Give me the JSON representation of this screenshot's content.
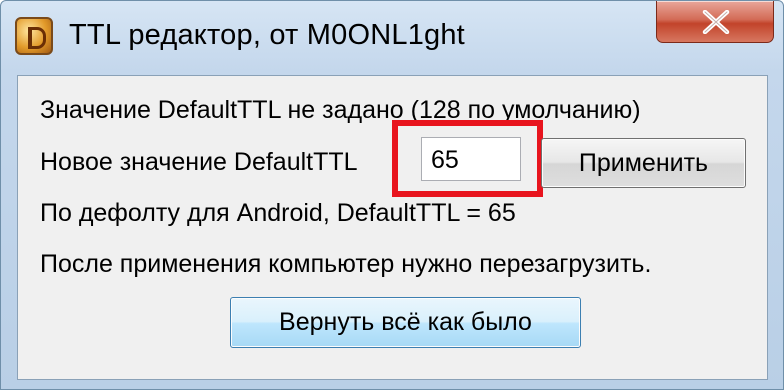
{
  "window": {
    "title": "TTL редактор, от M0ONL1ght",
    "close_icon": "close-icon",
    "app_icon": "app-icon"
  },
  "content": {
    "status_text": "Значение DefaultTTL не задано (128 по умолчанию)",
    "new_value_label": "Новое значение DefaultTTL",
    "ttl_input_value": "65",
    "apply_button": "Применить",
    "android_hint": "По дефолту для Android, DefaultTTL = 65",
    "restart_note": "После применения компьютер нужно перезагрузить.",
    "reset_button": "Вернуть всё как было"
  },
  "colors": {
    "highlight": "#e8141e",
    "close_button": "#c2432a",
    "default_button_accent": "#3c7fb1"
  }
}
